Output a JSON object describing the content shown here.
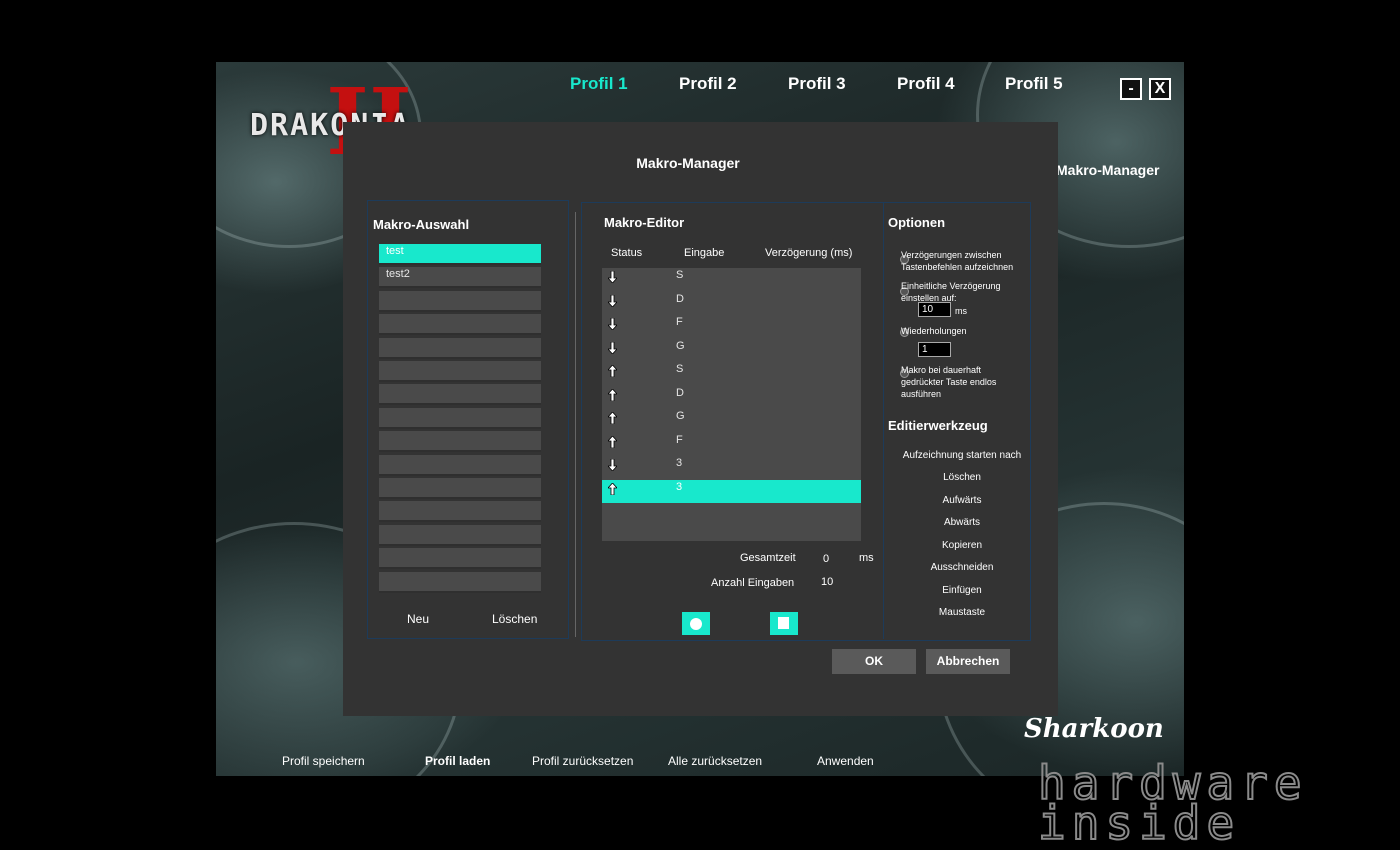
{
  "app": {
    "logo_text": "DRAKONIA",
    "logo_numeral": "II",
    "tabs": [
      "Profil 1",
      "Profil 2",
      "Profil 3",
      "Profil 4",
      "Profil 5"
    ],
    "active_tab": "Profil 1",
    "minimize_label": "-",
    "close_label": "X",
    "background_title": "Makro-Manager",
    "brand": "Sharkoon",
    "bottom_actions": [
      "Profil speichern",
      "Profil laden",
      "Profil zurücksetzen",
      "Alle zurücksetzen",
      "Anwenden"
    ]
  },
  "dialog": {
    "title": "Makro-Manager",
    "macro_select": {
      "heading": "Makro-Auswahl",
      "items": [
        "test",
        "test2",
        "",
        "",
        "",
        "",
        "",
        "",
        "",
        "",
        "",
        "",
        "",
        "",
        ""
      ],
      "selected": "test",
      "new_label": "Neu",
      "delete_label": "Löschen"
    },
    "editor": {
      "heading": "Makro-Editor",
      "columns": [
        "Status",
        "Eingabe",
        "Verzögerung (ms)"
      ],
      "rows": [
        {
          "status": "down",
          "key": "S"
        },
        {
          "status": "down",
          "key": "D"
        },
        {
          "status": "down",
          "key": "F"
        },
        {
          "status": "down",
          "key": "G"
        },
        {
          "status": "up",
          "key": "S"
        },
        {
          "status": "up",
          "key": "D"
        },
        {
          "status": "up",
          "key": "G"
        },
        {
          "status": "up",
          "key": "F"
        },
        {
          "status": "down",
          "key": "3"
        },
        {
          "status": "up",
          "key": "3"
        }
      ],
      "selected_row": 9,
      "total_time_label": "Gesamtzeit",
      "total_time_value": "0",
      "total_time_unit": "ms",
      "count_label": "Anzahl Eingaben",
      "count_value": "10",
      "record_icon": "record-icon",
      "stop_icon": "stop-icon"
    },
    "options": {
      "heading": "Optionen",
      "opt1": "Verzögerungen zwischen Tastenbefehlen aufzeichnen",
      "opt2": "Einheitliche Verzögerung einstellen auf:",
      "opt2_value": "10",
      "opt2_unit": "ms",
      "opt3": "Wiederholungen",
      "opt3_value": "1",
      "opt4": "Makro bei dauerhaft gedrückter Taste endlos ausführen"
    },
    "tools": {
      "heading": "Editierwerkzeug",
      "items": [
        "Aufzeichnung starten nach",
        "Löschen",
        "Aufwärts",
        "Abwärts",
        "Kopieren",
        "Ausschneiden",
        "Einfügen",
        "Maustaste"
      ]
    },
    "ok_label": "OK",
    "cancel_label": "Abbrechen"
  },
  "watermark": {
    "line1": "hardware",
    "line2": "inside"
  },
  "colors": {
    "accent": "#18e8cc",
    "dialog_bg": "#333333",
    "logo_red": "#c41010"
  }
}
